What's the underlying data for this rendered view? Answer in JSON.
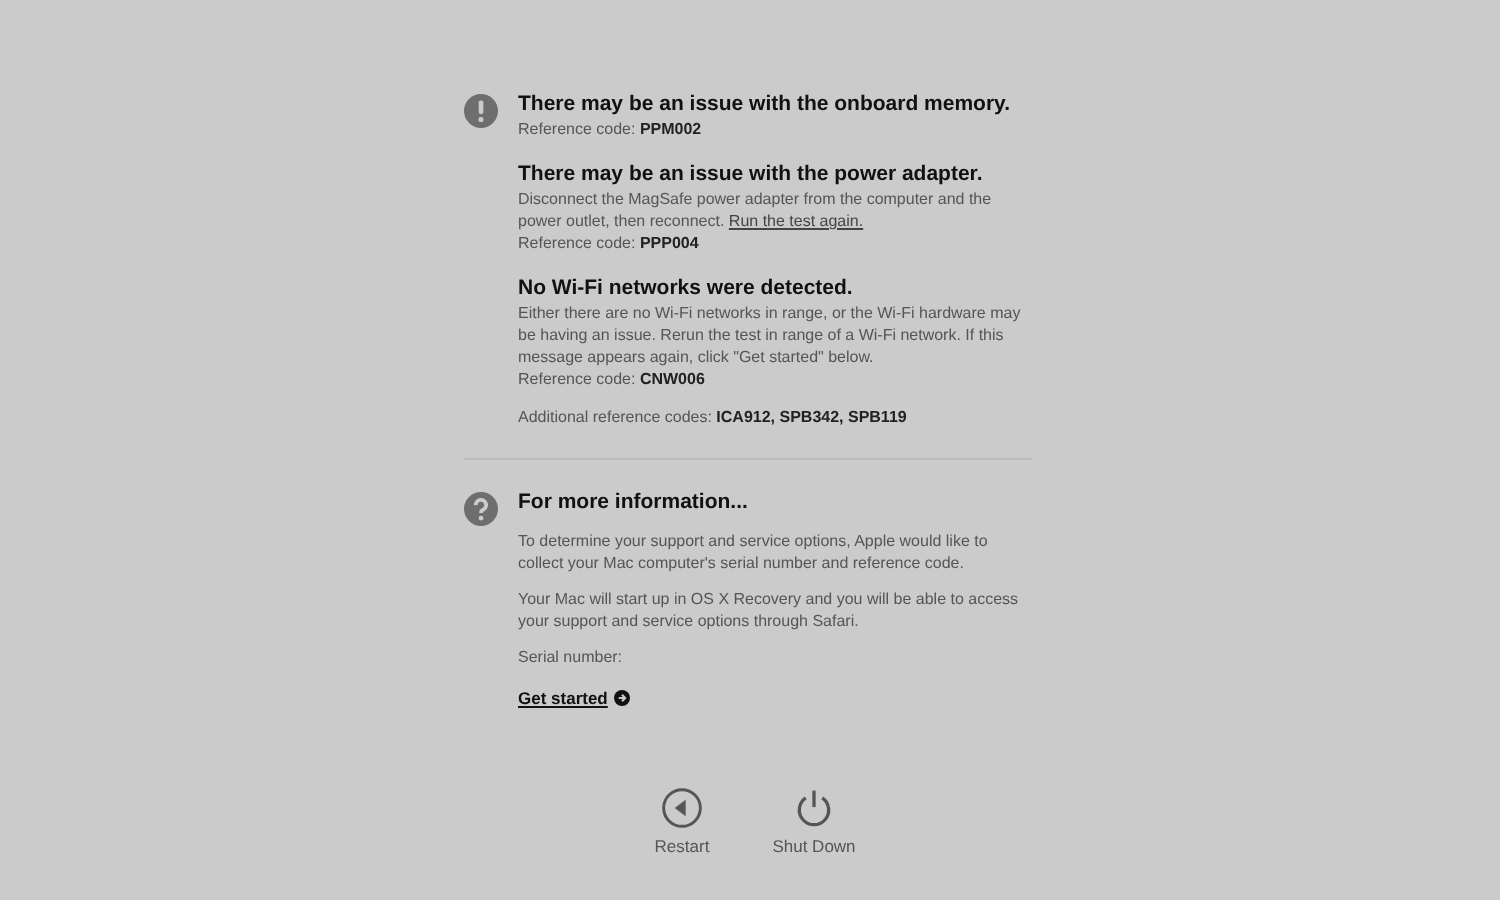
{
  "issues": [
    {
      "title": "There may be an issue with the onboard memory.",
      "reference": "Reference code: **PPM002**"
    },
    {
      "title": "There may be an issue with the power adapter.",
      "description": "Disconnect the MagSafe power adapter from the computer and the power outlet, then reconnect.",
      "link": "Run the test again.",
      "reference": "Reference code: **PPP004**"
    },
    {
      "title": "No Wi-Fi networks were detected.",
      "description": "Either there are no Wi-Fi networks in range, or the Wi-Fi hardware may be having an issue. Rerun the test in range of a Wi-Fi network. If this message appears again, click \"Get started\" below.",
      "reference": "Reference code: **CNW006**"
    }
  ],
  "additional": "Additional reference codes: **ICA912, SPB342, SPB119**",
  "info": {
    "title": "For more information...",
    "paragraphs": [
      "To determine your support and service options, Apple would like to collect your Mac computer's serial number and reference code.",
      "Your Mac will start up in OS X Recovery and you will be able to access your support and service options through Safari."
    ],
    "serial_label": "Serial number:",
    "get_started": "Get started"
  },
  "buttons": [
    {
      "kind": "restart",
      "label": "Restart"
    },
    {
      "kind": "shutdown",
      "label": "Shut Down"
    }
  ]
}
